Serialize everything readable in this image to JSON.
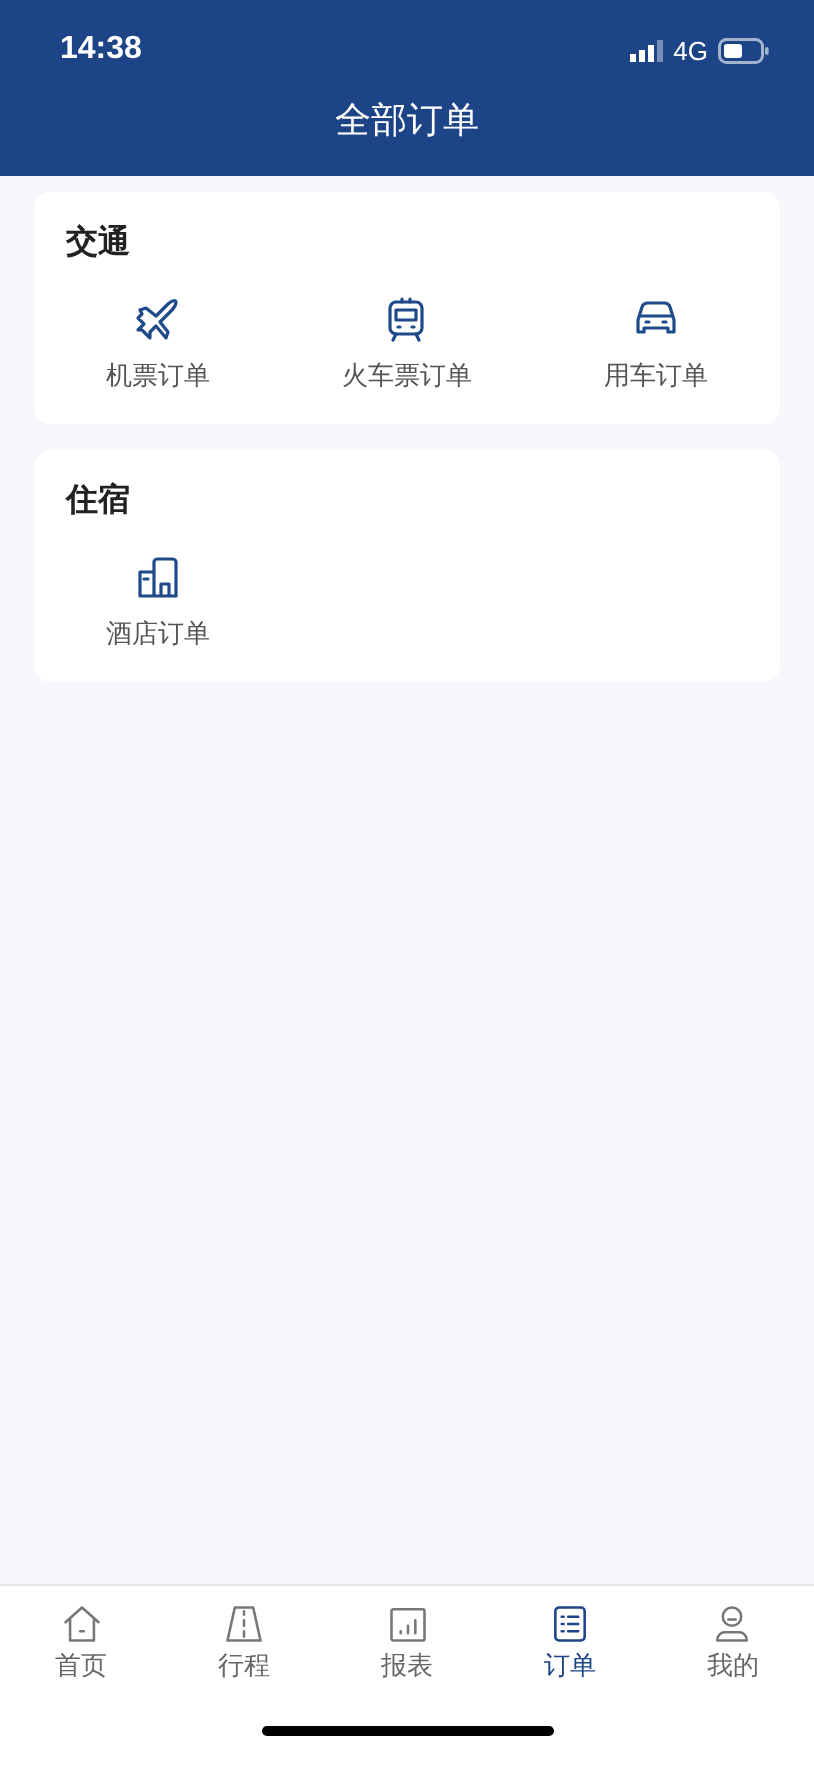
{
  "status_bar": {
    "time": "14:38",
    "network": "4G"
  },
  "header": {
    "title": "全部订单"
  },
  "sections": [
    {
      "title": "交通",
      "items": [
        {
          "kind": "plane",
          "label": "机票订单"
        },
        {
          "kind": "train",
          "label": "火车票订单"
        },
        {
          "kind": "car",
          "label": "用车订单"
        }
      ]
    },
    {
      "title": "住宿",
      "items": [
        {
          "kind": "hotel",
          "label": "酒店订单"
        }
      ]
    }
  ],
  "tab_bar": [
    {
      "kind": "home",
      "label": "首页",
      "selected": false
    },
    {
      "kind": "road",
      "label": "行程",
      "selected": false
    },
    {
      "kind": "chart",
      "label": "报表",
      "selected": false
    },
    {
      "kind": "list",
      "label": "订单",
      "selected": true
    },
    {
      "kind": "user",
      "label": "我的",
      "selected": false
    }
  ]
}
